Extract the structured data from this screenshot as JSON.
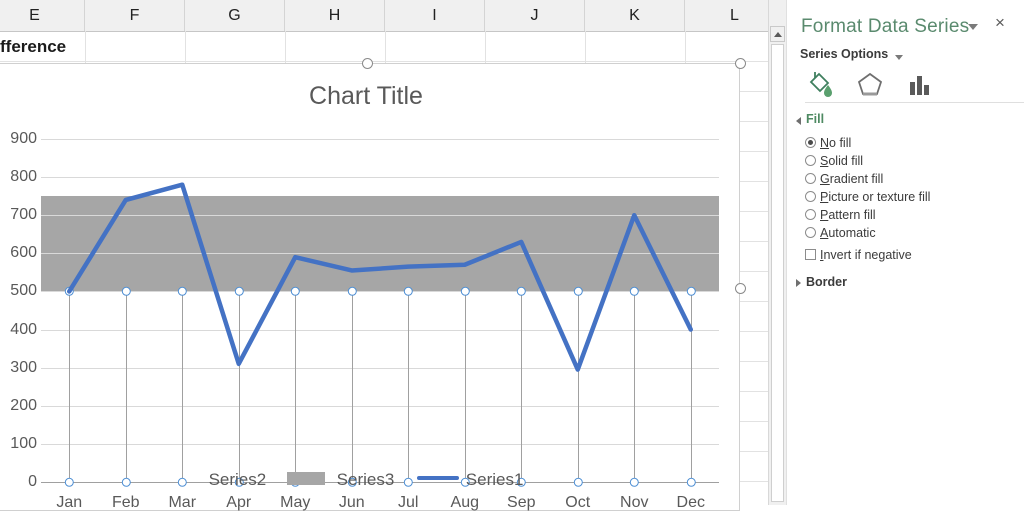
{
  "spreadsheet": {
    "column_headers": [
      "E",
      "F",
      "G",
      "H",
      "I",
      "J",
      "K",
      "L"
    ],
    "visible_cell_text": "fference"
  },
  "chart": {
    "title": "Chart Title",
    "legend": [
      {
        "name": "Series2",
        "marker": "none"
      },
      {
        "name": "Series3",
        "marker": "gray-swatch"
      },
      {
        "name": "Series1",
        "marker": "blue-line"
      }
    ]
  },
  "chart_data": {
    "type": "line",
    "title": "Chart Title",
    "xlabel": "",
    "ylabel": "",
    "ylim": [
      0,
      900
    ],
    "ytick_values": [
      0,
      100,
      200,
      300,
      400,
      500,
      600,
      700,
      800,
      900
    ],
    "grid": true,
    "legend_position": "bottom",
    "categories": [
      "Jan",
      "Feb",
      "Mar",
      "Apr",
      "May",
      "Jun",
      "Jul",
      "Aug",
      "Sep",
      "Oct",
      "Nov",
      "Dec"
    ],
    "series": [
      {
        "name": "Series2",
        "type": "stacked-column",
        "fill": "No fill",
        "values": [
          500,
          500,
          500,
          500,
          500,
          500,
          500,
          500,
          500,
          500,
          500,
          500
        ]
      },
      {
        "name": "Series3",
        "type": "stacked-column",
        "fill": "#A6A6A6",
        "values": [
          250,
          250,
          250,
          250,
          250,
          250,
          250,
          250,
          250,
          250,
          250,
          250
        ],
        "band_top": 750,
        "band_bottom": 500
      },
      {
        "name": "Series1",
        "type": "line",
        "color": "#4472C4",
        "values": [
          500,
          740,
          780,
          310,
          590,
          555,
          565,
          570,
          630,
          295,
          700,
          400
        ]
      }
    ]
  },
  "pane": {
    "title": "Format Data Series",
    "close_label": "×",
    "series_options_label": "Series Options",
    "icons": [
      {
        "name": "fill-and-line-icon",
        "selected": true
      },
      {
        "name": "effects-icon",
        "selected": false
      },
      {
        "name": "series-options-icon",
        "selected": false
      }
    ],
    "fill_section": {
      "heading": "Fill",
      "expanded": true,
      "options": [
        {
          "label": "No fill",
          "selected": true
        },
        {
          "label": "Solid fill",
          "selected": false
        },
        {
          "label": "Gradient fill",
          "selected": false
        },
        {
          "label": "Picture or texture fill",
          "selected": false
        },
        {
          "label": "Pattern fill",
          "selected": false
        },
        {
          "label": "Automatic",
          "selected": false
        }
      ],
      "checkbox": {
        "label": "Invert if negative",
        "checked": false
      }
    },
    "border_section": {
      "heading": "Border",
      "expanded": false
    }
  }
}
